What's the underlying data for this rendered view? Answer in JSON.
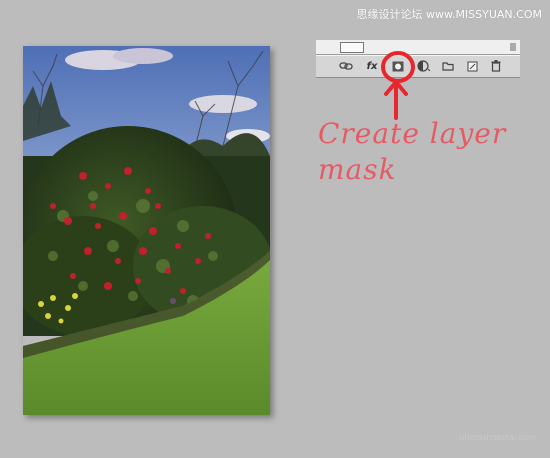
{
  "watermark": "思缘设计论坛 www.MISSYUAN.COM",
  "footer_mark": "photoshopstar.com",
  "layers_panel": {
    "toolbar_icons": [
      "link-layers-icon",
      "layer-style-icon",
      "add-layer-mask-icon",
      "adjustment-layer-icon",
      "new-group-icon",
      "new-layer-icon",
      "delete-layer-icon"
    ],
    "fx_label": "fx"
  },
  "annotation": {
    "line1": "Create layer",
    "line2": "mask",
    "color": "#e65a64"
  },
  "photo": {
    "subject": "garden-flowering-shrub",
    "sky_color": "#5f7fc0",
    "grass_color": "#6c9c38"
  }
}
